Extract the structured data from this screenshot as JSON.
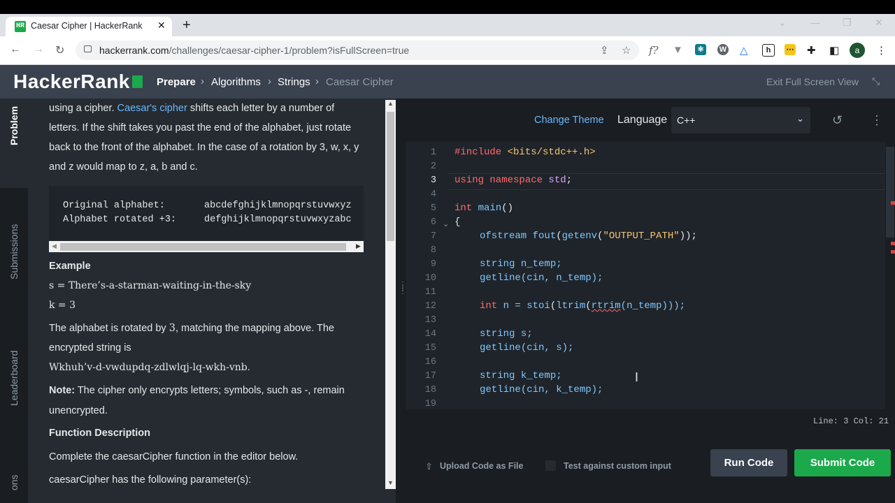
{
  "browser": {
    "tab_title": "Caesar Cipher | HackerRank",
    "tab_favicon": "HR",
    "url_host": "hackerrank.com",
    "url_path": "/challenges/caesar-cipher-1/problem?isFullScreen=true",
    "profile_initial": "a"
  },
  "header": {
    "logo": "HackerRank",
    "breadcrumbs": [
      "Prepare",
      "Algorithms",
      "Strings",
      "Caesar Cipher"
    ],
    "exit_fullscreen": "Exit Full Screen View"
  },
  "side_tabs": [
    "Problem",
    "Submissions",
    "Leaderboard",
    "ons"
  ],
  "problem": {
    "intro_1a": "using a cipher. ",
    "intro_link": "Caesar's cipher",
    "intro_1b": " shifts each letter by a number of",
    "intro_2": "letters. If the shift takes you past the end of the alphabet, just rotate",
    "intro_3": "back to the front of the alphabet. In the case of a rotation by 3, w, x, y",
    "intro_4": "and z would map to z, a, b and c.",
    "orig_label": "Original alphabet:",
    "orig_value": "abcdefghijklmnopqrstuvwxyz",
    "rot_label": "Alphabet rotated +3:",
    "rot_value": "defghijklmnopqrstuvwxyzabc",
    "example_heading": "Example",
    "ex_s": "s = There’s-a-starman-waiting-in-the-sky",
    "ex_k": "k = 3",
    "rotated_a": "The alphabet is rotated by ",
    "rotated_num": "3",
    "rotated_b": ", matching the mapping above. The",
    "encrypted_label": "encrypted string is",
    "encrypted_value": "Wkhuh’v-d-vwdupdq-zdlwlqj-lq-wkh-vnb",
    "encrypted_period": ".",
    "note_label": "Note:",
    "note_text_1": " The cipher only encrypts letters; symbols, such as -, remain",
    "note_text_2": "unencrypted.",
    "func_heading": "Function Description",
    "func_text": "Complete the caesarCipher function in the editor below.",
    "params_text": "caesarCipher has the following parameter(s):"
  },
  "editor": {
    "change_theme": "Change Theme",
    "language_label": "Language",
    "language_value": "C++",
    "line_numbers": [
      "1",
      "2",
      "3",
      "4",
      "5",
      "6",
      "7",
      "8",
      "9",
      "10",
      "11",
      "12",
      "13",
      "14",
      "15",
      "16",
      "17",
      "18",
      "19"
    ],
    "active_line": 3,
    "status": "Line: 3 Col: 21",
    "upload": "Upload Code as File",
    "custom_input": "Test against custom input",
    "run": "Run Code",
    "submit": "Submit Code"
  },
  "code": {
    "l1_a": "#include ",
    "l1_b": "<bits/stdc++.h>",
    "l3_a": "using namespace ",
    "l3_b": "std",
    "l3_c": ";",
    "l5_a": "int ",
    "l5_b": "main",
    "l5_c": "()",
    "l6": "{",
    "l7_a": "ofstream ",
    "l7_b": "fout",
    "l7_c": "(",
    "l7_d": "getenv",
    "l7_e": "(",
    "l7_f": "\"OUTPUT_PATH\"",
    "l7_g": "));",
    "l9_a": "string ",
    "l9_b": "n_temp;",
    "l10_a": "getline",
    "l10_b": "(cin, n_temp);",
    "l12_a": "int ",
    "l12_b": "n = ",
    "l12_c": "stoi",
    "l12_d": "(",
    "l12_e": "ltrim",
    "l12_f": "(",
    "l12_g": "rtrim",
    "l12_h": "(n_temp)));",
    "l14_a": "string ",
    "l14_b": "s;",
    "l15_a": "getline",
    "l15_b": "(cin, s);",
    "l17_a": "string ",
    "l17_b": "k_temp;",
    "l18_a": "getline",
    "l18_b": "(cin, k_temp);"
  },
  "colors": {
    "brand_green": "#1ba94c",
    "header_bg": "#39424e",
    "link_blue": "#68b7ff"
  }
}
